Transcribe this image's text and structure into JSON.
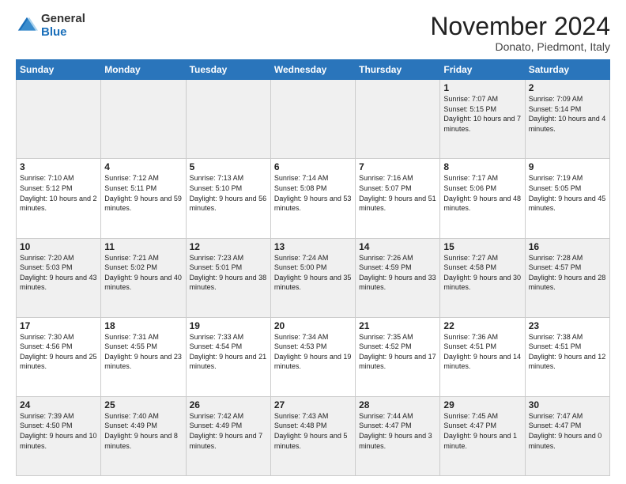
{
  "header": {
    "logo_general": "General",
    "logo_blue": "Blue",
    "month_title": "November 2024",
    "location": "Donato, Piedmont, Italy"
  },
  "days_of_week": [
    "Sunday",
    "Monday",
    "Tuesday",
    "Wednesday",
    "Thursday",
    "Friday",
    "Saturday"
  ],
  "weeks": [
    [
      {
        "day": "",
        "info": ""
      },
      {
        "day": "",
        "info": ""
      },
      {
        "day": "",
        "info": ""
      },
      {
        "day": "",
        "info": ""
      },
      {
        "day": "",
        "info": ""
      },
      {
        "day": "1",
        "info": "Sunrise: 7:07 AM\nSunset: 5:15 PM\nDaylight: 10 hours and 7 minutes."
      },
      {
        "day": "2",
        "info": "Sunrise: 7:09 AM\nSunset: 5:14 PM\nDaylight: 10 hours and 4 minutes."
      }
    ],
    [
      {
        "day": "3",
        "info": "Sunrise: 7:10 AM\nSunset: 5:12 PM\nDaylight: 10 hours and 2 minutes."
      },
      {
        "day": "4",
        "info": "Sunrise: 7:12 AM\nSunset: 5:11 PM\nDaylight: 9 hours and 59 minutes."
      },
      {
        "day": "5",
        "info": "Sunrise: 7:13 AM\nSunset: 5:10 PM\nDaylight: 9 hours and 56 minutes."
      },
      {
        "day": "6",
        "info": "Sunrise: 7:14 AM\nSunset: 5:08 PM\nDaylight: 9 hours and 53 minutes."
      },
      {
        "day": "7",
        "info": "Sunrise: 7:16 AM\nSunset: 5:07 PM\nDaylight: 9 hours and 51 minutes."
      },
      {
        "day": "8",
        "info": "Sunrise: 7:17 AM\nSunset: 5:06 PM\nDaylight: 9 hours and 48 minutes."
      },
      {
        "day": "9",
        "info": "Sunrise: 7:19 AM\nSunset: 5:05 PM\nDaylight: 9 hours and 45 minutes."
      }
    ],
    [
      {
        "day": "10",
        "info": "Sunrise: 7:20 AM\nSunset: 5:03 PM\nDaylight: 9 hours and 43 minutes."
      },
      {
        "day": "11",
        "info": "Sunrise: 7:21 AM\nSunset: 5:02 PM\nDaylight: 9 hours and 40 minutes."
      },
      {
        "day": "12",
        "info": "Sunrise: 7:23 AM\nSunset: 5:01 PM\nDaylight: 9 hours and 38 minutes."
      },
      {
        "day": "13",
        "info": "Sunrise: 7:24 AM\nSunset: 5:00 PM\nDaylight: 9 hours and 35 minutes."
      },
      {
        "day": "14",
        "info": "Sunrise: 7:26 AM\nSunset: 4:59 PM\nDaylight: 9 hours and 33 minutes."
      },
      {
        "day": "15",
        "info": "Sunrise: 7:27 AM\nSunset: 4:58 PM\nDaylight: 9 hours and 30 minutes."
      },
      {
        "day": "16",
        "info": "Sunrise: 7:28 AM\nSunset: 4:57 PM\nDaylight: 9 hours and 28 minutes."
      }
    ],
    [
      {
        "day": "17",
        "info": "Sunrise: 7:30 AM\nSunset: 4:56 PM\nDaylight: 9 hours and 25 minutes."
      },
      {
        "day": "18",
        "info": "Sunrise: 7:31 AM\nSunset: 4:55 PM\nDaylight: 9 hours and 23 minutes."
      },
      {
        "day": "19",
        "info": "Sunrise: 7:33 AM\nSunset: 4:54 PM\nDaylight: 9 hours and 21 minutes."
      },
      {
        "day": "20",
        "info": "Sunrise: 7:34 AM\nSunset: 4:53 PM\nDaylight: 9 hours and 19 minutes."
      },
      {
        "day": "21",
        "info": "Sunrise: 7:35 AM\nSunset: 4:52 PM\nDaylight: 9 hours and 17 minutes."
      },
      {
        "day": "22",
        "info": "Sunrise: 7:36 AM\nSunset: 4:51 PM\nDaylight: 9 hours and 14 minutes."
      },
      {
        "day": "23",
        "info": "Sunrise: 7:38 AM\nSunset: 4:51 PM\nDaylight: 9 hours and 12 minutes."
      }
    ],
    [
      {
        "day": "24",
        "info": "Sunrise: 7:39 AM\nSunset: 4:50 PM\nDaylight: 9 hours and 10 minutes."
      },
      {
        "day": "25",
        "info": "Sunrise: 7:40 AM\nSunset: 4:49 PM\nDaylight: 9 hours and 8 minutes."
      },
      {
        "day": "26",
        "info": "Sunrise: 7:42 AM\nSunset: 4:49 PM\nDaylight: 9 hours and 7 minutes."
      },
      {
        "day": "27",
        "info": "Sunrise: 7:43 AM\nSunset: 4:48 PM\nDaylight: 9 hours and 5 minutes."
      },
      {
        "day": "28",
        "info": "Sunrise: 7:44 AM\nSunset: 4:47 PM\nDaylight: 9 hours and 3 minutes."
      },
      {
        "day": "29",
        "info": "Sunrise: 7:45 AM\nSunset: 4:47 PM\nDaylight: 9 hours and 1 minute."
      },
      {
        "day": "30",
        "info": "Sunrise: 7:47 AM\nSunset: 4:47 PM\nDaylight: 9 hours and 0 minutes."
      }
    ]
  ]
}
